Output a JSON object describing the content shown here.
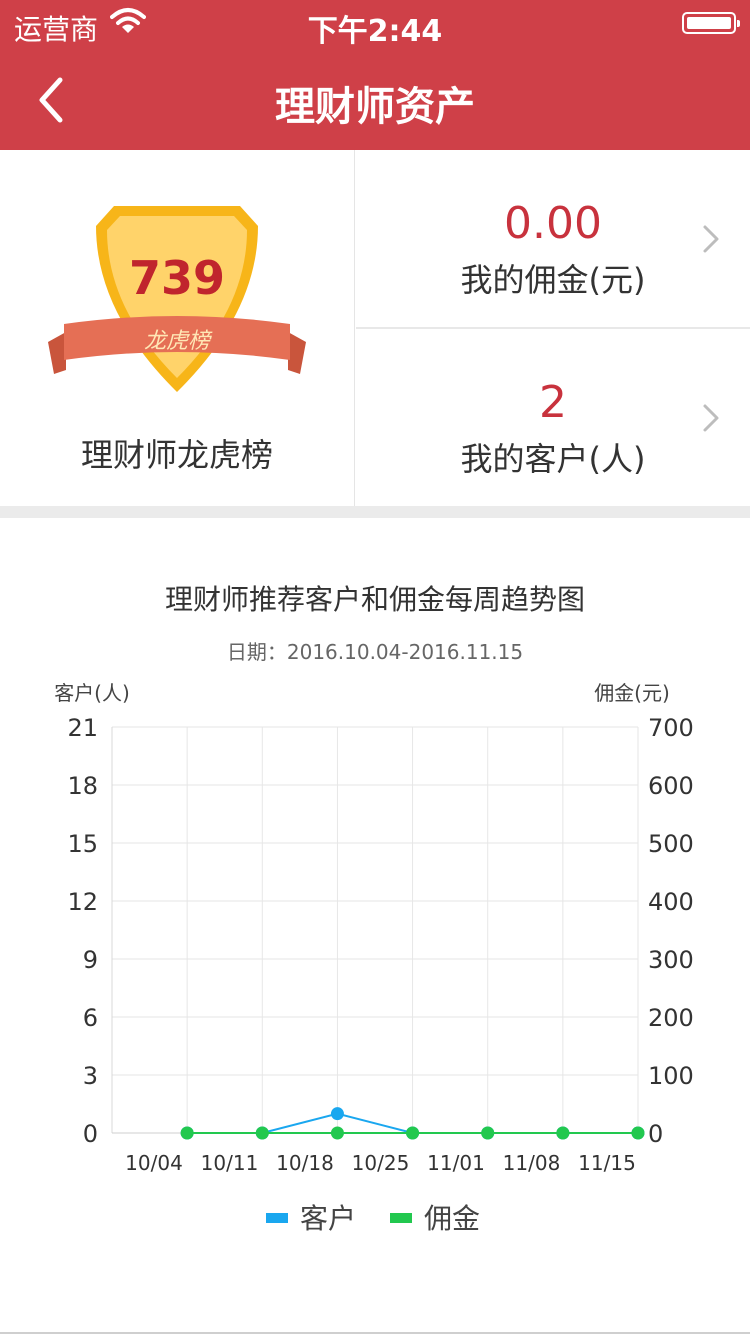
{
  "status_bar": {
    "carrier": "运营商",
    "time": "下午2:44"
  },
  "nav": {
    "title": "理财师资产"
  },
  "rank": {
    "number": "739",
    "ribbon": "龙虎榜",
    "label": "理财师龙虎榜"
  },
  "commission": {
    "value": "0.00",
    "label": "我的佣金(元)"
  },
  "customers": {
    "value": "2",
    "label": "我的客户(人)"
  },
  "chart": {
    "title": "理财师推荐客户和佣金每周趋势图",
    "subtitle": "日期：2016.10.04-2016.11.15"
  },
  "colors": {
    "brand_red": "#cf4048",
    "customer_line": "#1aa7ef",
    "commission_line": "#22c84f"
  },
  "chart_data": {
    "type": "line",
    "x": [
      "10/04",
      "10/11",
      "10/18",
      "10/25",
      "11/01",
      "11/08",
      "11/15"
    ],
    "x_ticks": [
      "10/04",
      "10/11",
      "10/18",
      "10/25",
      "11/01",
      "11/08",
      "11/15"
    ],
    "x_points": [
      "10/07",
      "10/14",
      "10/21",
      "10/28",
      "11/04",
      "11/11",
      "11/18"
    ],
    "ylabel": "客户(人)",
    "y2label": "佣金(元)",
    "ylim": [
      0,
      21
    ],
    "y2lim": [
      0,
      700
    ],
    "y_ticks": [
      0,
      3,
      6,
      9,
      12,
      15,
      18,
      21
    ],
    "y2_ticks": [
      0,
      100,
      200,
      300,
      400,
      500,
      600,
      700
    ],
    "grid": true,
    "legend_position": "bottom",
    "series": [
      {
        "name": "客户",
        "axis": "left",
        "color": "#1aa7ef",
        "values": [
          0,
          0,
          1,
          0,
          0,
          0,
          0
        ]
      },
      {
        "name": "佣金",
        "axis": "right",
        "color": "#22c84f",
        "values": [
          0,
          0,
          0,
          0,
          0,
          0,
          0
        ]
      }
    ]
  }
}
